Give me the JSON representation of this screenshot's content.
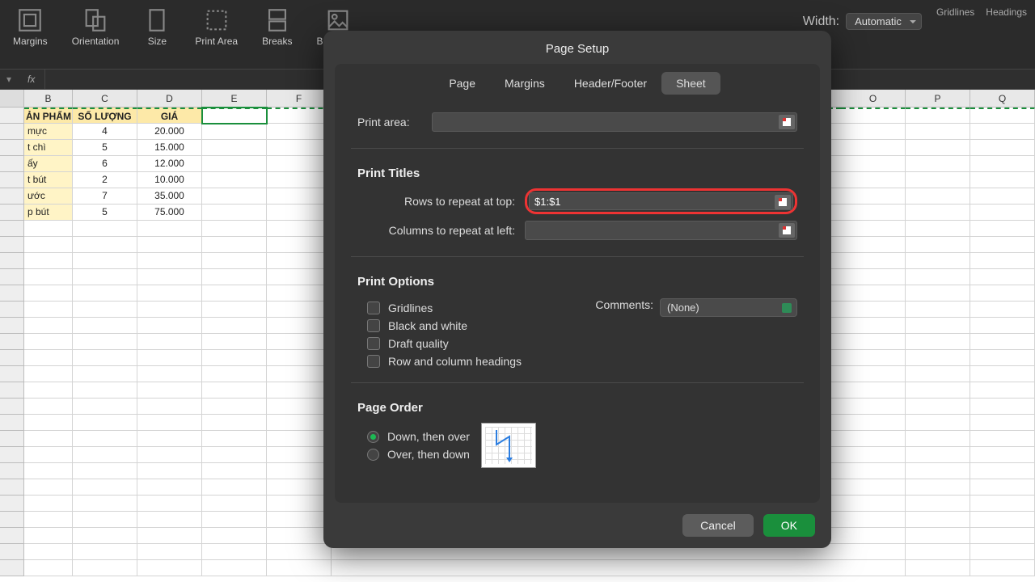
{
  "ribbon": {
    "items": [
      "Margins",
      "Orientation",
      "Size",
      "Print Area",
      "Breaks",
      "Backgro..."
    ],
    "width_label": "Width:",
    "width_value": "Automatic",
    "gridlines": "Gridlines",
    "headings": "Headings"
  },
  "fx": "fx",
  "columns": [
    "B",
    "C",
    "D",
    "E",
    "F",
    "",
    "",
    "",
    "",
    "",
    "",
    "",
    "O",
    "P",
    "Q"
  ],
  "sheet": {
    "header": [
      "ẢN PHẨM",
      "SỐ LƯỢNG",
      "GIÁ"
    ],
    "rows": [
      [
        "mực",
        "4",
        "20.000"
      ],
      [
        "t chì",
        "5",
        "15.000"
      ],
      [
        "ấy",
        "6",
        "12.000"
      ],
      [
        "t bút",
        "2",
        "10.000"
      ],
      [
        "ước",
        "7",
        "35.000"
      ],
      [
        "p bút",
        "5",
        "75.000"
      ]
    ]
  },
  "dialog": {
    "title": "Page Setup",
    "tabs": [
      "Page",
      "Margins",
      "Header/Footer",
      "Sheet"
    ],
    "active_tab": 3,
    "print_area_label": "Print area:",
    "print_area_value": "",
    "print_titles": "Print Titles",
    "rows_repeat_label": "Rows to repeat at top:",
    "rows_repeat_value": "$1:$1",
    "cols_repeat_label": "Columns to repeat at left:",
    "cols_repeat_value": "",
    "print_options": "Print Options",
    "opt_gridlines": "Gridlines",
    "opt_bw": "Black and white",
    "opt_draft": "Draft quality",
    "opt_rowcol": "Row and column headings",
    "comments_label": "Comments:",
    "comments_value": "(None)",
    "page_order": "Page Order",
    "order_down": "Down, then over",
    "order_over": "Over, then down",
    "cancel": "Cancel",
    "ok": "OK"
  }
}
